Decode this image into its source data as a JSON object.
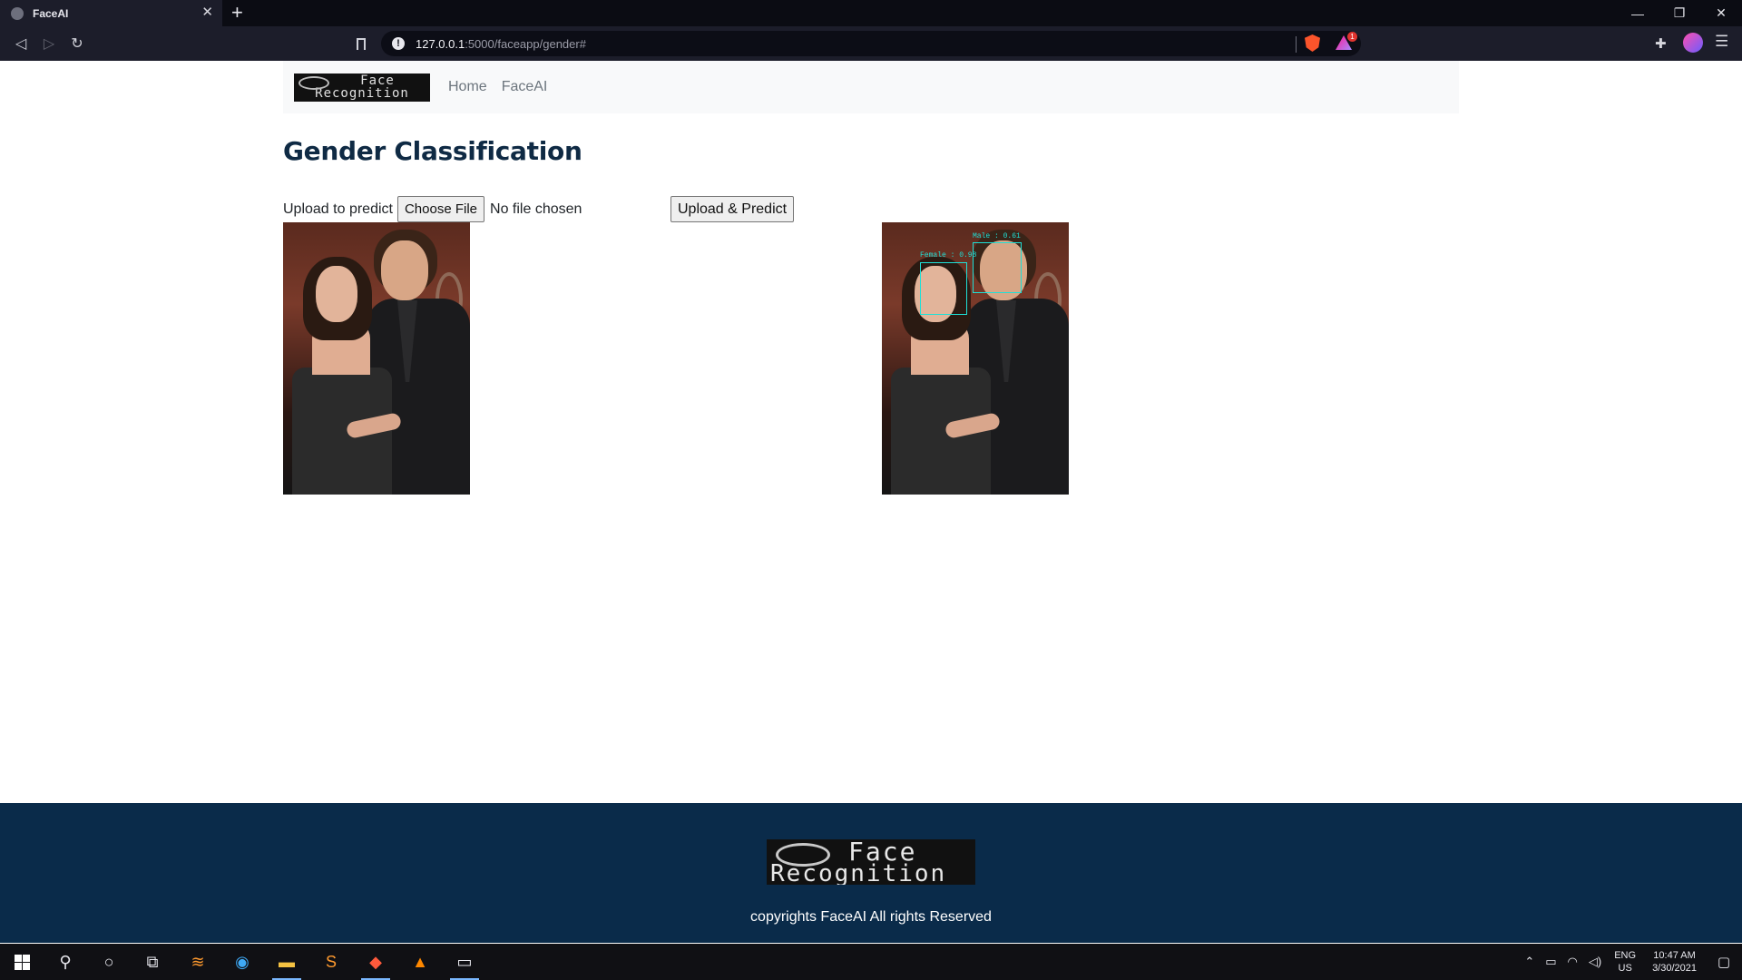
{
  "browser": {
    "tab_title": "FaceAI",
    "tab_close": "✕",
    "new_tab": "+",
    "url_host": "127.0.0.1",
    "url_path": ":5000/faceapp/gender#",
    "rewards_badge": "1",
    "window_controls": {
      "minimize": "—",
      "restore": "❐",
      "close": "✕"
    }
  },
  "navbar": {
    "logo_line1": "Face",
    "logo_line2": "Recognition",
    "links": [
      {
        "label": "Home"
      },
      {
        "label": "FaceAI"
      }
    ]
  },
  "page": {
    "title": "Gender Classification",
    "upload_label": "Upload to predict",
    "choose_file_label": "Choose File",
    "no_file_text": "No file chosen",
    "predict_button": "Upload & Predict",
    "detections": [
      {
        "label": "Female : 0.98",
        "color": "#1ee0d7"
      },
      {
        "label": "Male : 0.61",
        "color": "#1ee0d7"
      }
    ]
  },
  "footer": {
    "logo_line1": "Face",
    "logo_line2": "Recognition",
    "copyright": "copyrights FaceAI All rights Reserved",
    "background": "#0a2b4a"
  },
  "taskbar": {
    "language": "ENG",
    "region": "US",
    "time": "10:47 AM",
    "date": "3/30/2021",
    "icons": [
      "windows-start-icon",
      "search-icon",
      "cortana-icon",
      "task-view-icon",
      "sublime-merge-icon",
      "edge-icon",
      "file-explorer-icon",
      "sublime-text-icon",
      "brave-icon",
      "vlc-icon",
      "terminal-icon"
    ]
  },
  "colors": {
    "title": "#0f2a44",
    "accent_box": "#1ee0d7",
    "navbar_bg": "#f8f9fa"
  }
}
